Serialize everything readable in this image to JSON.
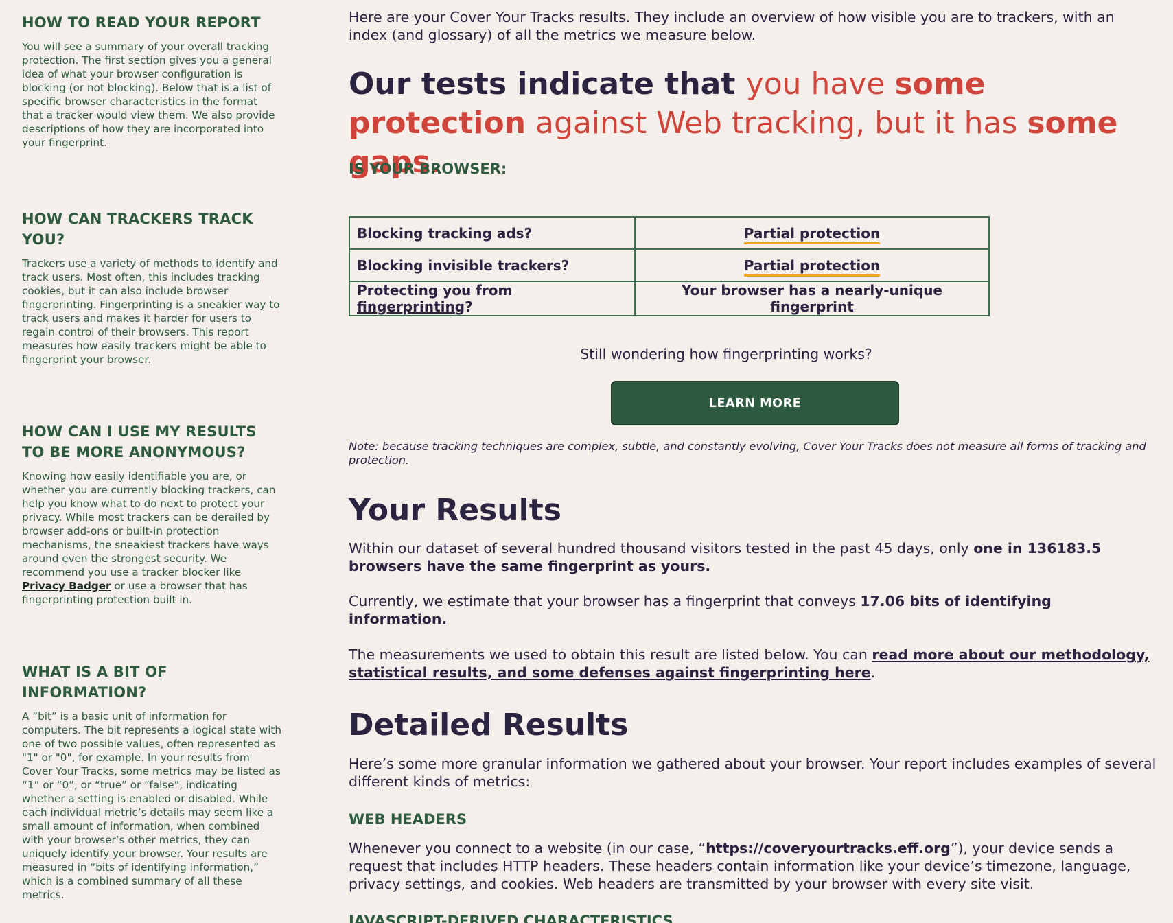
{
  "sidebar": {
    "sections": [
      {
        "heading": "HOW TO READ YOUR REPORT",
        "body": "You will see a summary of your overall tracking protection. The first section gives you a general idea of what your browser configuration is blocking (or not blocking). Below that is a list of specific browser characteristics in the format that a tracker would view them. We also provide descriptions of how they are incorporated into your fingerprint."
      },
      {
        "heading": "HOW CAN TRACKERS TRACK YOU?",
        "body": "Trackers use a variety of methods to identify and track users. Most often, this includes tracking cookies, but it can also include browser fingerprinting. Fingerprinting is a sneakier way to track users and makes it harder for users to regain control of their browsers. This report measures how easily trackers might be able to fingerprint your browser."
      },
      {
        "heading": "HOW CAN I USE MY RESULTS TO BE MORE ANONYMOUS?",
        "body_before": "Knowing how easily identifiable you are, or whether you are currently blocking trackers, can help you know what to do next to protect your privacy. While most trackers can be derailed by browser add-ons or built-in protection mechanisms, the sneakiest trackers have ways around even the strongest security. We recommend you use a tracker blocker like ",
        "link": "Privacy Badger",
        "body_after": " or use a browser that has fingerprinting protection built in."
      },
      {
        "heading": "WHAT IS A BIT OF INFORMATION?",
        "body": "A “bit” is a basic unit of information for computers. The bit represents a logical state with one of two possible values, often represented as \"1\" or \"0\", for example. In your results from Cover Your Tracks, some metrics may be listed as “1” or “0”, or “true” or “false”, indicating whether a setting is enabled or disabled. While each individual metric’s details may seem like a small amount of information, when combined with your browser’s other metrics, they can uniquely identify your browser. Your results are measured in “bits of identifying information,” which is a combined summary of all these metrics."
      }
    ]
  },
  "main": {
    "intro": "Here are your Cover Your Tracks results. They include an overview of how visible you are to trackers, with an index (and glossary) of all the metrics we measure below.",
    "verdict": {
      "part1": "Our tests indicate that ",
      "part2": "you have ",
      "part3": "some protection",
      "part4": " against Web tracking, but it has ",
      "part5": "some gaps",
      "part6": "."
    },
    "browser_heading": "IS YOUR BROWSER:",
    "table": {
      "row1_q": "Blocking tracking ads?",
      "row1_a": "Partial protection",
      "row2_q": "Blocking invisible trackers?",
      "row2_a": "Partial protection",
      "row3_q_before": "Protecting you from ",
      "row3_q_link": "fingerprinting",
      "row3_q_after": "?",
      "row3_a": "Your browser has a nearly-unique fingerprint"
    },
    "wonder": "Still wondering how fingerprinting works?",
    "learn_more": "LEARN MORE",
    "note": "Note: because tracking techniques are complex, subtle, and constantly evolving, Cover Your Tracks does not measure all forms of tracking and protection.",
    "results_heading": "Your Results",
    "results_p1_before": "Within our dataset of several hundred thousand visitors tested in the past 45 days, only ",
    "results_p1_bold": "one in 136183.5 browsers have the same fingerprint as yours.",
    "results_p2_before": "Currently, we estimate that your browser has a fingerprint that conveys ",
    "results_p2_bold": "17.06 bits of identifying information.",
    "results_p3_before": "The measurements we used to obtain this result are listed below. You can ",
    "results_p3_link": "read more about our methodology, statistical results, and some defenses against fingerprinting here",
    "results_p3_after": ".",
    "detailed_heading": "Detailed Results",
    "detailed_intro": "Here’s some more granular information we gathered about your browser. Your report includes examples of several different kinds of metrics:",
    "web_headers_heading": "WEB HEADERS",
    "web_headers_before": "Whenever you connect to a website (in our case, “",
    "web_headers_url": "https://coveryourtracks.eff.org",
    "web_headers_after": "”), your device sends a request that includes HTTP headers. These headers contain information like your device’s timezone, language, privacy settings, and cookies. Web headers are transmitted by your browser with every site visit.",
    "js_heading": "JAVASCRIPT-DERIVED CHARACTERISTICS"
  },
  "colors": {
    "background": "#f4efeb",
    "heading_green": "#2e5a3f",
    "accent_red": "#d0453b",
    "text_dark": "#2a2440",
    "partial_underline": "#f0a422"
  }
}
